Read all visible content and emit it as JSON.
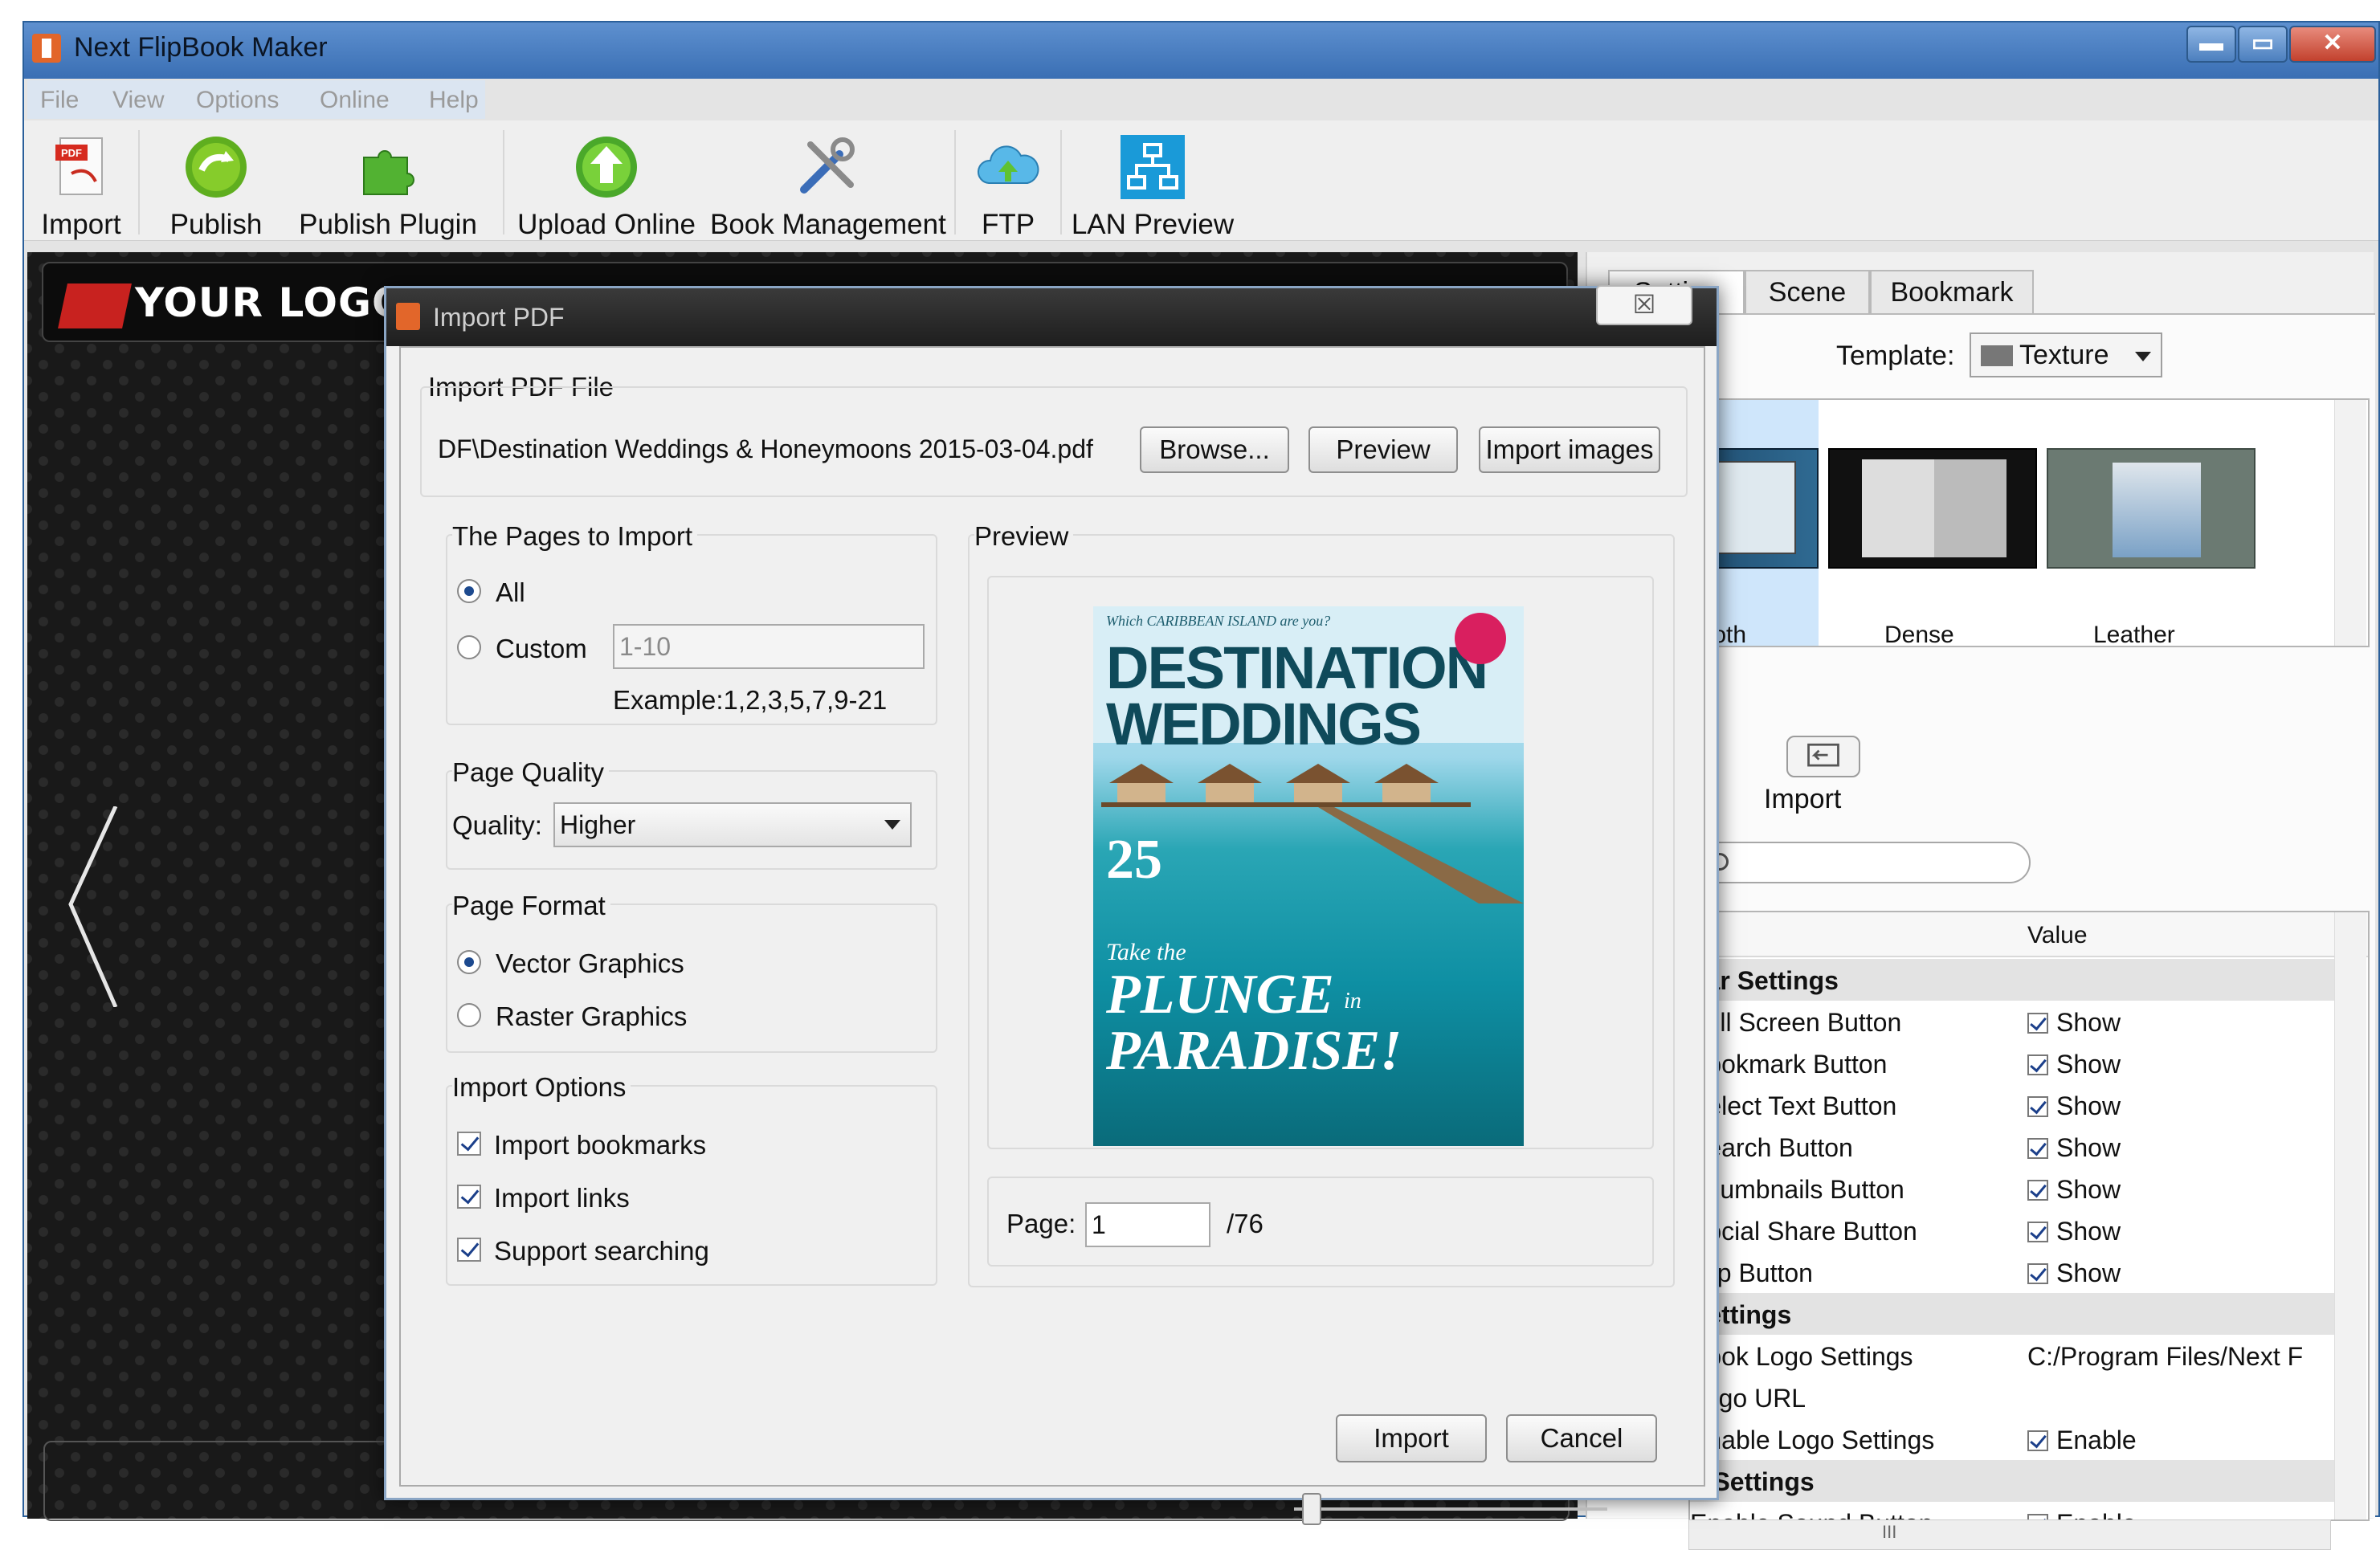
{
  "window": {
    "title": "Next FlipBook Maker",
    "controls": [
      "▬",
      "▭",
      "✕"
    ]
  },
  "menu": [
    "File",
    "View",
    "Options",
    "Online",
    "Help"
  ],
  "toolbar": [
    {
      "label": "Import",
      "icon": "pdf-import-icon"
    },
    {
      "label": "Publish",
      "icon": "publish-icon"
    },
    {
      "label": "Publish Plugin",
      "icon": "puzzle-icon"
    },
    {
      "label": "Upload Online",
      "icon": "upload-icon"
    },
    {
      "label": "Book Management",
      "icon": "tools-icon"
    },
    {
      "label": "FTP",
      "icon": "cloud-icon"
    },
    {
      "label": "LAN Preview",
      "icon": "network-icon"
    }
  ],
  "viewer": {
    "logo": "YOUR LOGO"
  },
  "right_panel": {
    "tabs": [
      "Setting",
      "Scene",
      "Bookmark"
    ],
    "template_label": "Template:",
    "template_value": "Texture",
    "templates": [
      "Cloth",
      "Dense",
      "Leather"
    ],
    "import_label": "Import",
    "grid_header_value": "Value",
    "rows": [
      {
        "type": "section",
        "key": "bar Settings"
      },
      {
        "key": "Full Screen Button",
        "value": "Show",
        "check": true
      },
      {
        "key": "Bookmark Button",
        "value": "Show",
        "check": true
      },
      {
        "key": "Select Text Button",
        "value": "Show",
        "check": true
      },
      {
        "key": "Search Button",
        "value": "Show",
        "check": true
      },
      {
        "key": "Thumbnails Button",
        "value": "Show",
        "check": true
      },
      {
        "key": "Social Share Button",
        "value": "Show",
        "check": true
      },
      {
        "key": "Flip Button",
        "value": "Show",
        "check": true
      },
      {
        "type": "section",
        "key": "Settings"
      },
      {
        "key": "Book Logo Settings",
        "value": "C:/Program Files/Next F",
        "check": false
      },
      {
        "key": "Logo URL",
        "value": "",
        "check": false
      },
      {
        "key": "Enable Logo Settings",
        "value": "Enable",
        "check": true
      },
      {
        "type": "section",
        "key": "d Settings"
      },
      {
        "key": "Enable Sound Button",
        "value": "Enable",
        "check": true
      }
    ],
    "hscroll_grip": "III"
  },
  "dialog": {
    "title": "Import PDF",
    "close": "☒",
    "import_file_label": "Import PDF File",
    "file_path": "DF\\Destination Weddings & Honeymoons 2015-03-04.pdf",
    "browse": "Browse...",
    "preview_btn": "Preview",
    "import_images": "Import images",
    "pages_group": "The Pages to Import",
    "all": "All",
    "custom": "Custom",
    "custom_value": "1-10",
    "example": "Example:1,2,3,5,7,9-21",
    "quality_group": "Page Quality",
    "quality_label": "Quality:",
    "quality_value": "Higher",
    "format_group": "Page Format",
    "vector": "Vector Graphics",
    "raster": "Raster Graphics",
    "options_group": "Import Options",
    "opt_bookmarks": "Import bookmarks",
    "opt_links": "Import links",
    "opt_search": "Support searching",
    "preview_group": "Preview",
    "page_label": "Page:",
    "page_value": "1",
    "page_total": "/76",
    "page_position": 1,
    "import_btn": "Import",
    "cancel_btn": "Cancel"
  },
  "cover": {
    "top_line": "Which CARIBBEAN ISLAND are you?",
    "headline1": "DESTINATION",
    "headline2": "WEDDINGS",
    "number": "25",
    "tag": "Take the",
    "plunge": "PLUNGE",
    "in": "in",
    "paradise": "PARADISE!"
  }
}
